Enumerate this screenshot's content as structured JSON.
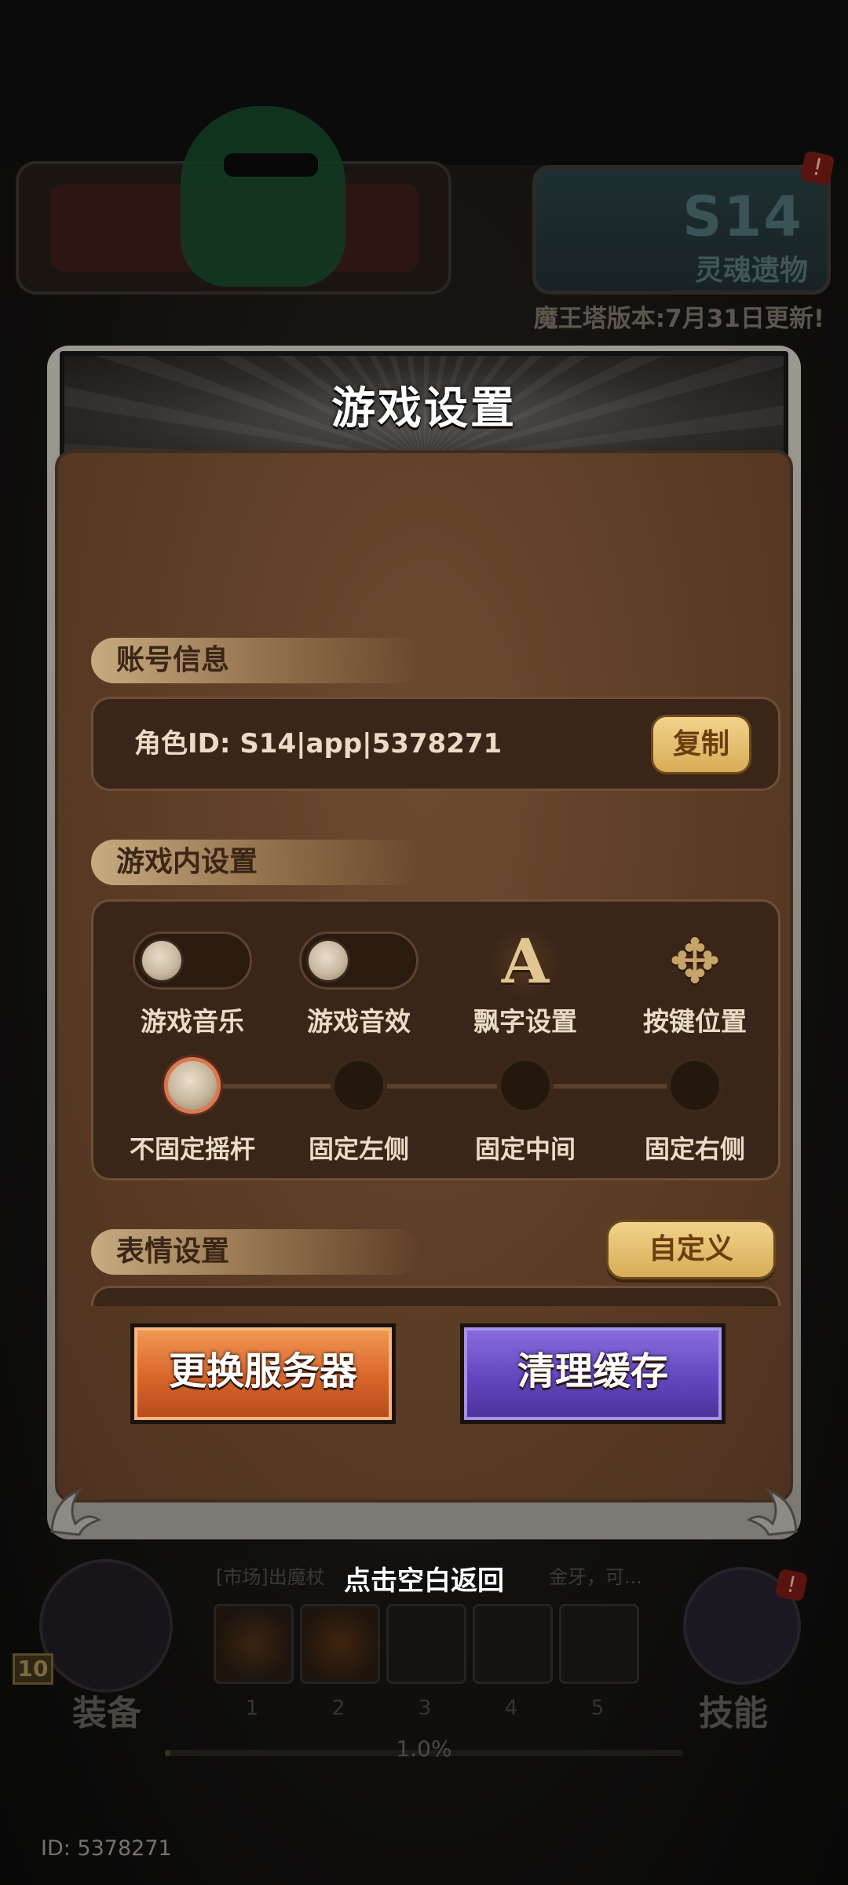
{
  "background": {
    "season": {
      "title": "S14",
      "subtitle": "灵魂遗物",
      "alert": "!"
    },
    "version_note": "魔王塔版本:7月31日更新!",
    "equipment": {
      "label": "装备",
      "level": "10"
    },
    "skills": {
      "label": "技能",
      "alert": "!"
    },
    "chat": {
      "line_mid": "[市场]出魔杖",
      "line_right": "金牙，可..."
    },
    "slots": [
      "1",
      "2",
      "3",
      "4",
      "5"
    ],
    "progress": {
      "text": "1.0%",
      "value": 0.01
    },
    "player_id": "ID: 5378271"
  },
  "dialog": {
    "title": "游戏设置",
    "account": {
      "section_label": "账号信息",
      "role_id_label": "角色ID: ",
      "role_id_value": "S14|app|5378271",
      "copy_label": "复制"
    },
    "ingame": {
      "section_label": "游戏内设置",
      "controls": [
        {
          "label": "游戏音乐",
          "type": "toggle",
          "on": false
        },
        {
          "label": "游戏音效",
          "type": "toggle",
          "on": false
        },
        {
          "label": "飘字设置",
          "type": "icon",
          "icon": "letter-a-icon",
          "glyph": "A"
        },
        {
          "label": "按键位置",
          "type": "icon",
          "icon": "move-arrows-icon",
          "glyph": "✥"
        }
      ],
      "joystick": [
        {
          "label": "不固定摇杆",
          "selected": true
        },
        {
          "label": "固定左侧",
          "selected": false
        },
        {
          "label": "固定中间",
          "selected": false
        },
        {
          "label": "固定右侧",
          "selected": false
        }
      ]
    },
    "emote": {
      "section_label": "表情设置",
      "custom_label": "自定义"
    },
    "buttons": {
      "change_server": "更换服务器",
      "clear_cache": "清理缓存"
    }
  },
  "back_hint": "点击空白返回",
  "colors": {
    "accent_gold": "#d8ac58",
    "button_orange": "#d8652a",
    "button_purple": "#6246be",
    "panel_brown": "#5c3c25"
  }
}
